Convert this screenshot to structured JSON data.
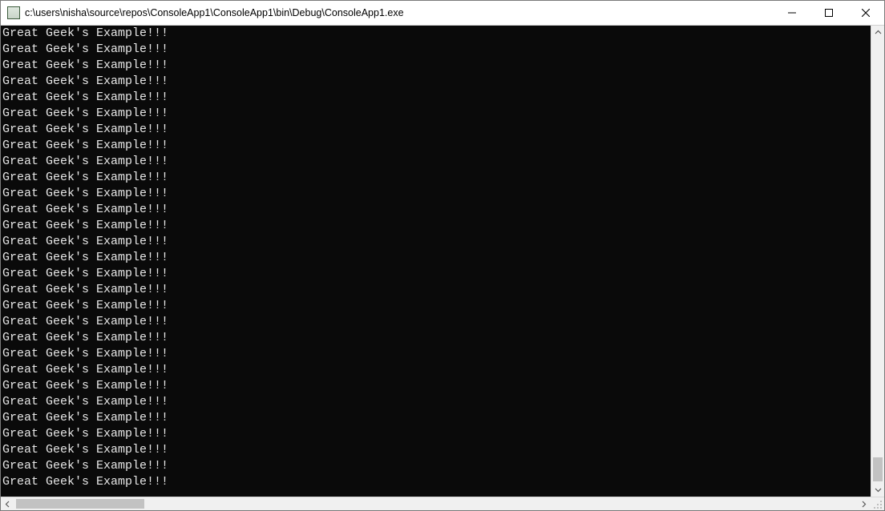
{
  "window": {
    "title": "c:\\users\\nisha\\source\\repos\\ConsoleApp1\\ConsoleApp1\\bin\\Debug\\ConsoleApp1.exe"
  },
  "console": {
    "line_text": "Great Geek's Example!!!",
    "line_count": 29
  }
}
